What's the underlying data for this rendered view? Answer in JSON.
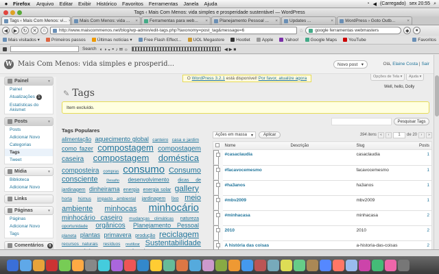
{
  "menubar": {
    "app": "Firefox",
    "menus": [
      "Arquivo",
      "Editar",
      "Exibir",
      "Histórico",
      "Favoritos",
      "Ferramentas",
      "Janela",
      "Ajuda"
    ],
    "status": "(Carregado)",
    "clock": "sex 20:55"
  },
  "window_title": "Tags ‹ Mais Com Menos: vida simples e prosperidade sustentável — WordPress",
  "tabs": [
    {
      "label": "Tags ‹ Mais Com Menos: vi..."
    },
    {
      "label": "Mais Com Menos: vida ..."
    },
    {
      "label": "Ferramentas para web..."
    },
    {
      "label": "Planejamento Pessoal ..."
    },
    {
      "label": "Updates ..."
    },
    {
      "label": "WordPress › Goto Outb..."
    }
  ],
  "navbar": {
    "url": "http://www.maiscommenos.net/blog/wp-admin/edit-tags.php?taxonomy=post_tag&message=6",
    "search": "google ferramentas webmasters"
  },
  "bookmarks": [
    "Mais visitados ▾",
    "Primeiros passos",
    "Últimas notícias ▾",
    "Free Flash Effect...",
    "UOL Megastore",
    "Hootlet",
    "Apple",
    "Yahoo!",
    "Google Maps",
    "YouTube",
    "Favoritos"
  ],
  "addonbar": {
    "search_label": "Search"
  },
  "wp": {
    "site_name": "Mais Com Menos: vida simples e prosperid...",
    "fav_button": "Novo post",
    "howdy_text": "Olá, ",
    "user": "Elaine Costa",
    "logout": "Sair",
    "update_prefix": "O ",
    "update_link": "WordPress 3.2.1",
    "update_mid": " está disponível! ",
    "update_link2": "Por favor, atualize agora",
    "screen_options": "Opções de Tela ▾",
    "help": "Ajuda ▾",
    "hello": "Well, hello, Dolly",
    "page_title": "Tags",
    "notice": "Item excluído.",
    "search_button": "Pesquisar Tags",
    "popular_title": "Tags Populares",
    "bulk_actions": "Ações em massa",
    "apply": "Aplicar",
    "items_count": "394 itens",
    "page_current": "1",
    "page_total": "de 20"
  },
  "sidebar": {
    "painel": "Painel",
    "painel_items": [
      "Painel",
      "Atualizações",
      "Estatísticas do Akismet"
    ],
    "updates_badge": "1",
    "posts": "Posts",
    "posts_items": [
      "Posts",
      "Adicionar Novo",
      "Categorias",
      "Tags",
      "Tweet"
    ],
    "midia": "Mídia",
    "midia_items": [
      "Biblioteca",
      "Adicionar Novo"
    ],
    "links": "Links",
    "paginas": "Páginas",
    "paginas_items": [
      "Páginas",
      "Adicionar Novo",
      "Tags"
    ],
    "comentarios": "Comentários",
    "comments_badge": "0"
  },
  "table": {
    "headers": {
      "name": "Nome",
      "desc": "Descrição",
      "slug": "Slug",
      "posts": "Posts"
    },
    "rows": [
      {
        "name": "#casaclaudia",
        "desc": "",
        "slug": "casaclaudia",
        "posts": "1"
      },
      {
        "name": "#facavocemesmo",
        "desc": "",
        "slug": "facavocemesmo",
        "posts": "1"
      },
      {
        "name": "#ha3anos",
        "desc": "",
        "slug": "ha3anos",
        "posts": "1"
      },
      {
        "name": "#mbv2009",
        "desc": "",
        "slug": "mbv2009",
        "posts": "1"
      },
      {
        "name": "#minhacasa",
        "desc": "",
        "slug": "minhacasa",
        "posts": "2"
      },
      {
        "name": "2010",
        "desc": "",
        "slug": "2010",
        "posts": "2"
      },
      {
        "name": "A história das coisas",
        "desc": "",
        "slug": "a-historia-das-coisas",
        "posts": "2"
      }
    ]
  },
  "tagcloud": [
    {
      "t": "alimentação",
      "s": 8
    },
    {
      "t": "aquecimento global",
      "s": 9
    },
    {
      "t": "canteiro",
      "s": 6.5
    },
    {
      "t": "casa e jardim",
      "s": 6.5
    },
    {
      "t": "como fazer",
      "s": 9
    },
    {
      "t": "compostagem",
      "s": 13
    },
    {
      "t": "compostagem caseira",
      "s": 10
    },
    {
      "t": "compostagem",
      "s": 13
    },
    {
      "t": "doméstica",
      "s": 13
    },
    {
      "t": "composteira",
      "s": 10
    },
    {
      "t": "compras",
      "s": 6
    },
    {
      "t": "consumo",
      "s": 15
    },
    {
      "t": "Consumo consciente",
      "s": 11
    },
    {
      "t": "Desafio",
      "s": 5.5
    },
    {
      "t": "desenvolvimento",
      "s": 8
    },
    {
      "t": "dicas de jardinagem",
      "s": 7
    },
    {
      "t": "dinheirama",
      "s": 9
    },
    {
      "t": "energia",
      "s": 7
    },
    {
      "t": "energia solar",
      "s": 7
    },
    {
      "t": "gallery",
      "s": 12
    },
    {
      "t": "horta",
      "s": 6.5
    },
    {
      "t": "húmus",
      "s": 6.5
    },
    {
      "t": "impacto ambiental",
      "s": 6.5
    },
    {
      "t": "jardinagem",
      "s": 7
    },
    {
      "t": "lixo",
      "s": 7
    },
    {
      "t": "meio ambiente",
      "s": 11
    },
    {
      "t": "minhocas",
      "s": 11
    },
    {
      "t": "minhocário",
      "s": 15
    },
    {
      "t": "minhocário caseiro",
      "s": 10
    },
    {
      "t": "mudanças climáticas",
      "s": 6.5
    },
    {
      "t": "natureza",
      "s": 7
    },
    {
      "t": "oportunidade",
      "s": 6.5
    },
    {
      "t": "orgânicos",
      "s": 10
    },
    {
      "t": "Planejamento Pessoal",
      "s": 9
    },
    {
      "t": "planeta",
      "s": 6.5
    },
    {
      "t": "plantas",
      "s": 9
    },
    {
      "t": "primavera",
      "s": 9
    },
    {
      "t": "produção",
      "s": 7
    },
    {
      "t": "reciclagem",
      "s": 12
    },
    {
      "t": "recursos naturais",
      "s": 6.5
    },
    {
      "t": "resíduos",
      "s": 6.5
    },
    {
      "t": "reutilizar",
      "s": 5.5
    },
    {
      "t": "Sustentabilidade na",
      "s": 11
    },
    {
      "t": "prática",
      "s": 12
    },
    {
      "t": "sustentável",
      "s": 12
    },
    {
      "t": "Vida Simples",
      "s": 8
    },
    {
      "t": "viveiro de mudas",
      "s": 7
    }
  ],
  "colors": {
    "link": "#21759b",
    "notice_bg": "#ffffe0",
    "notice_border": "#e6db55"
  }
}
